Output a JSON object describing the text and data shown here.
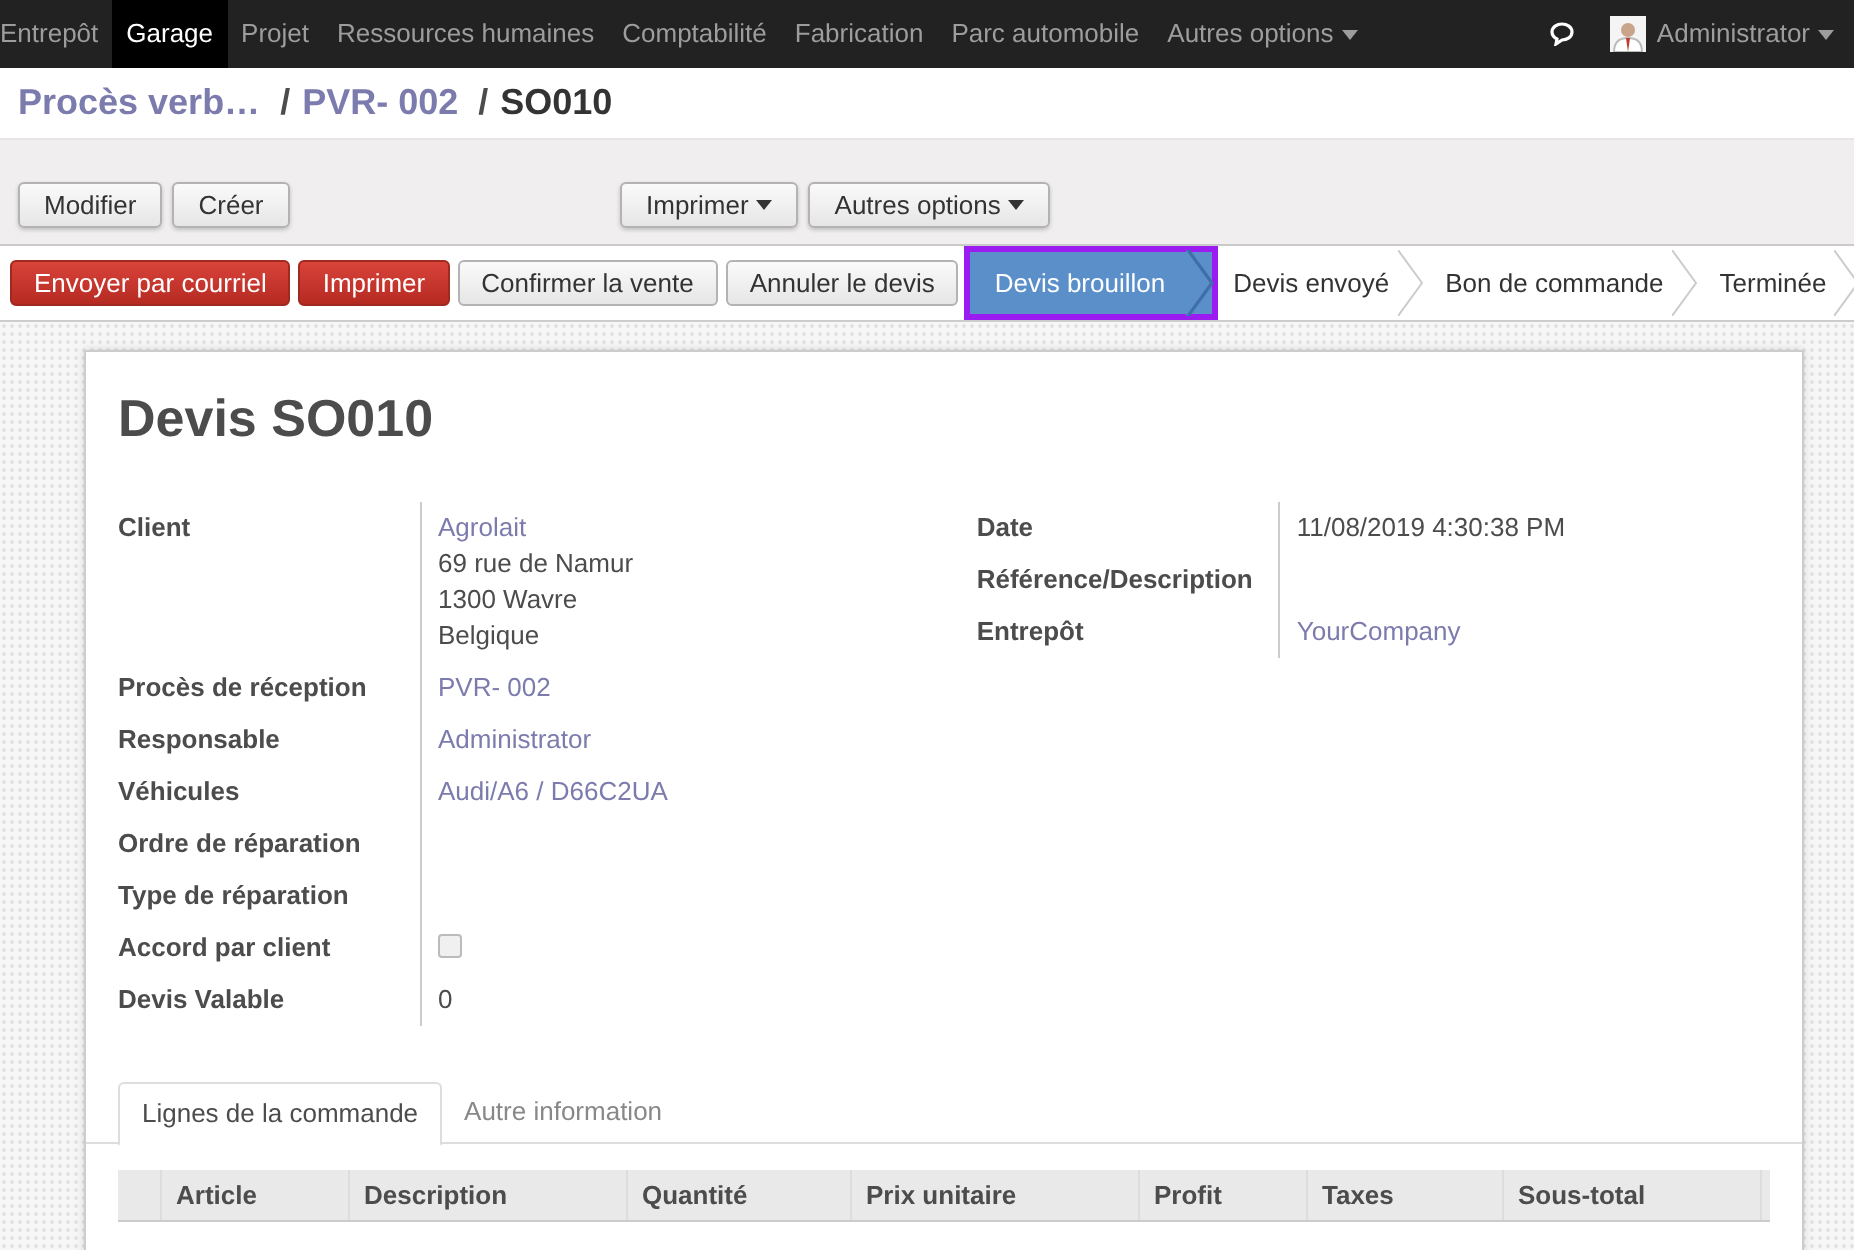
{
  "top_menu": [
    {
      "label": "Entrepôt",
      "selected": false
    },
    {
      "label": "Garage",
      "selected": true
    },
    {
      "label": "Projet",
      "selected": false
    },
    {
      "label": "Ressources humaines",
      "selected": false
    },
    {
      "label": "Comptabilité",
      "selected": false
    },
    {
      "label": "Fabrication",
      "selected": false
    },
    {
      "label": "Parc automobile",
      "selected": false
    },
    {
      "label": "Autres options",
      "selected": false,
      "dropdown": true
    }
  ],
  "user": {
    "name": "Administrator"
  },
  "breadcrumb": [
    {
      "label": "Procès verb…",
      "kind": "link"
    },
    {
      "label": "/",
      "kind": "separator"
    },
    {
      "label": "PVR- 002",
      "kind": "link"
    },
    {
      "label": "/",
      "kind": "separator"
    },
    {
      "label": "SO010",
      "kind": "current"
    }
  ],
  "control_buttons": [
    "Modifier",
    "Créer"
  ],
  "sidebar_buttons": [
    "Imprimer",
    "Autres options"
  ],
  "action_buttons": [
    {
      "label": "Envoyer par courriel",
      "kind": "danger"
    },
    {
      "label": "Imprimer",
      "kind": "danger"
    },
    {
      "label": "Confirmer la vente",
      "kind": "default"
    },
    {
      "label": "Annuler le devis",
      "kind": "default"
    }
  ],
  "stages": [
    {
      "label": "Devis brouillon",
      "selected": true
    },
    {
      "label": "Devis envoyé",
      "selected": false
    },
    {
      "label": "Bon de commande",
      "selected": false
    },
    {
      "label": "Terminée",
      "selected": false
    }
  ],
  "form": {
    "title": "Devis SO010",
    "left_fields": [
      {
        "label": "Client",
        "kind": "value",
        "values": [
          {
            "text": "Agrolait",
            "link": true
          },
          {
            "text": "69 rue de Namur",
            "link": false
          },
          {
            "text": "1300 Wavre",
            "link": false
          },
          {
            "text": "Belgique",
            "link": false
          }
        ]
      },
      {
        "label": "Procès de réception",
        "kind": "value",
        "values": [
          {
            "text": "PVR- 002",
            "link": true
          }
        ]
      },
      {
        "label": "Responsable",
        "kind": "value",
        "values": [
          {
            "text": "Administrator",
            "link": true
          }
        ]
      },
      {
        "label": "Véhicules",
        "kind": "value",
        "values": [
          {
            "text": "Audi/A6 / D66C2UA",
            "link": true
          }
        ]
      },
      {
        "label": "Ordre de réparation",
        "kind": "value"
      },
      {
        "label": "Type de réparation",
        "kind": "value"
      },
      {
        "label": "Accord par client",
        "kind": "checkbox",
        "checked": false
      },
      {
        "label": "Devis Valable",
        "kind": "value",
        "values": [
          {
            "text": "0",
            "link": false
          }
        ]
      }
    ],
    "right_fields": [
      {
        "label": "Date",
        "kind": "value",
        "values": [
          {
            "text": "11/08/2019 4:30:38 PM",
            "link": false
          }
        ]
      },
      {
        "label": "Référence/Description",
        "kind": "value"
      },
      {
        "label": "Entrepôt",
        "kind": "value",
        "values": [
          {
            "text": "YourCompany",
            "link": true
          }
        ]
      }
    ],
    "tabs": [
      {
        "label": "Lignes de la commande",
        "selected": true
      },
      {
        "label": "Autre information",
        "selected": false
      }
    ],
    "table": {
      "columns": [
        "Article",
        "Description",
        "Quantité",
        "Prix unitaire",
        "Profit",
        "Taxes",
        "Sous-total"
      ]
    }
  }
}
